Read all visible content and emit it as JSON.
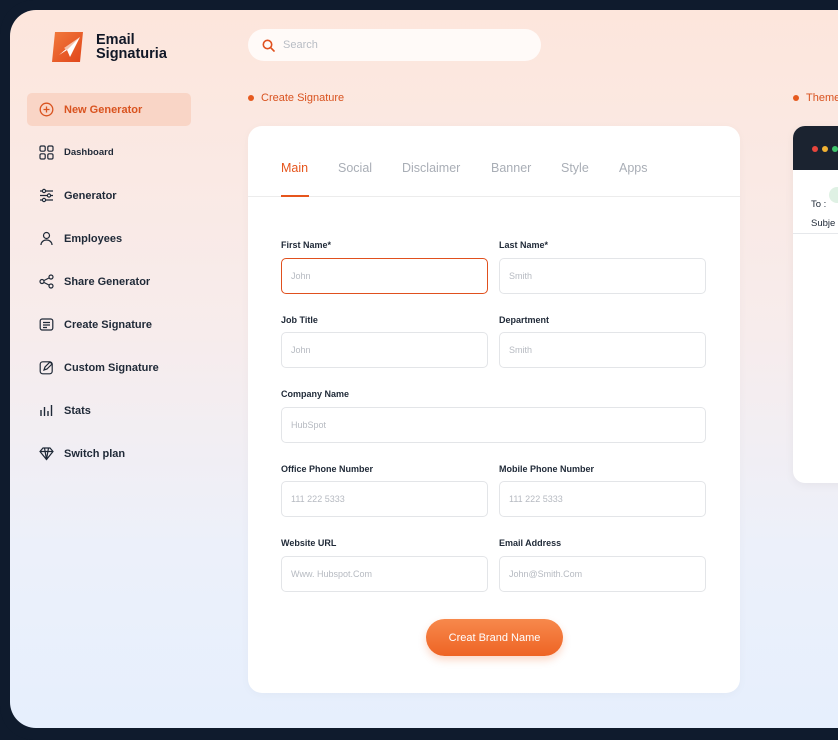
{
  "app": {
    "name_line1": "Email",
    "name_line2": "Signaturia",
    "accent": "#e6551c"
  },
  "search": {
    "placeholder": "Search"
  },
  "sidebar": {
    "items": [
      {
        "label": "New Generator",
        "icon": "plus-circle-icon",
        "active": true
      },
      {
        "label": "Dashboard",
        "icon": "grid-icon"
      },
      {
        "label": "Generator",
        "icon": "sliders-icon"
      },
      {
        "label": "Employees",
        "icon": "user-icon"
      },
      {
        "label": "Share Generator",
        "icon": "share-icon"
      },
      {
        "label": "Create Signature",
        "icon": "document-icon"
      },
      {
        "label": "Custom Signature",
        "icon": "edit-icon"
      },
      {
        "label": "Stats",
        "icon": "bar-chart-icon"
      },
      {
        "label": "Switch plan",
        "icon": "diamond-icon"
      }
    ]
  },
  "main": {
    "section_title": "Create Signature",
    "tabs": [
      "Main",
      "Social",
      "Disclaimer",
      "Banner",
      "Style",
      "Apps"
    ],
    "active_tab": "Main",
    "fields": {
      "first_name": {
        "label": "First Name*",
        "placeholder": "John"
      },
      "last_name": {
        "label": "Last Name*",
        "placeholder": "Smith"
      },
      "job_title": {
        "label": "Job Title",
        "placeholder": "John"
      },
      "department": {
        "label": "Department",
        "placeholder": "Smith"
      },
      "company_name": {
        "label": "Company Name",
        "placeholder": "HubSpot"
      },
      "office_phone": {
        "label": "Office Phone Number",
        "placeholder": "111 222 5333"
      },
      "mobile_phone": {
        "label": "Mobile Phone Number",
        "placeholder": "111 222 5333"
      },
      "website": {
        "label": "Website URL",
        "placeholder": "Www. Hubspot.Com"
      },
      "email": {
        "label": "Email Address",
        "placeholder": "John@Smith.Com"
      }
    },
    "submit_label": "Creat Brand Name"
  },
  "preview": {
    "section_title": "Theme",
    "to_label": "To :",
    "subject_label": "Subje"
  }
}
